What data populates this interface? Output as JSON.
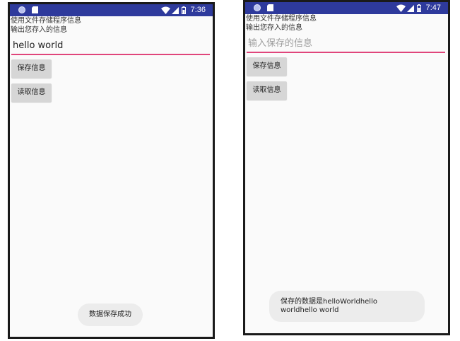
{
  "screens": [
    {
      "status_time": "7:36",
      "texts": [
        "使用文件存储程序信息",
        "输出您存入的信息"
      ],
      "input": {
        "value": "hello world",
        "placeholder": ""
      },
      "buttons": {
        "save": "保存信息",
        "read": "读取信息"
      },
      "toast": "数据保存成功"
    },
    {
      "status_time": "7:47",
      "texts": [
        "使用文件存储程序信息",
        "输出您存入的信息"
      ],
      "input": {
        "value": "",
        "placeholder": "输入保存的信息"
      },
      "buttons": {
        "save": "保存信息",
        "read": "读取信息"
      },
      "toast": "保存的数据是helloWorldhello worldhello world"
    }
  ],
  "icons": {
    "status_left": [
      "notification-dot-icon",
      "sd-card-icon"
    ],
    "status_right": [
      "wifi-icon",
      "cell-signal-icon",
      "battery-icon"
    ]
  },
  "colors": {
    "status_bar": "#2e3a9c",
    "input_underline": "#e0457b",
    "screen_background": "#fafafa",
    "button": "#d6d6d6",
    "toast": "#ececec"
  }
}
